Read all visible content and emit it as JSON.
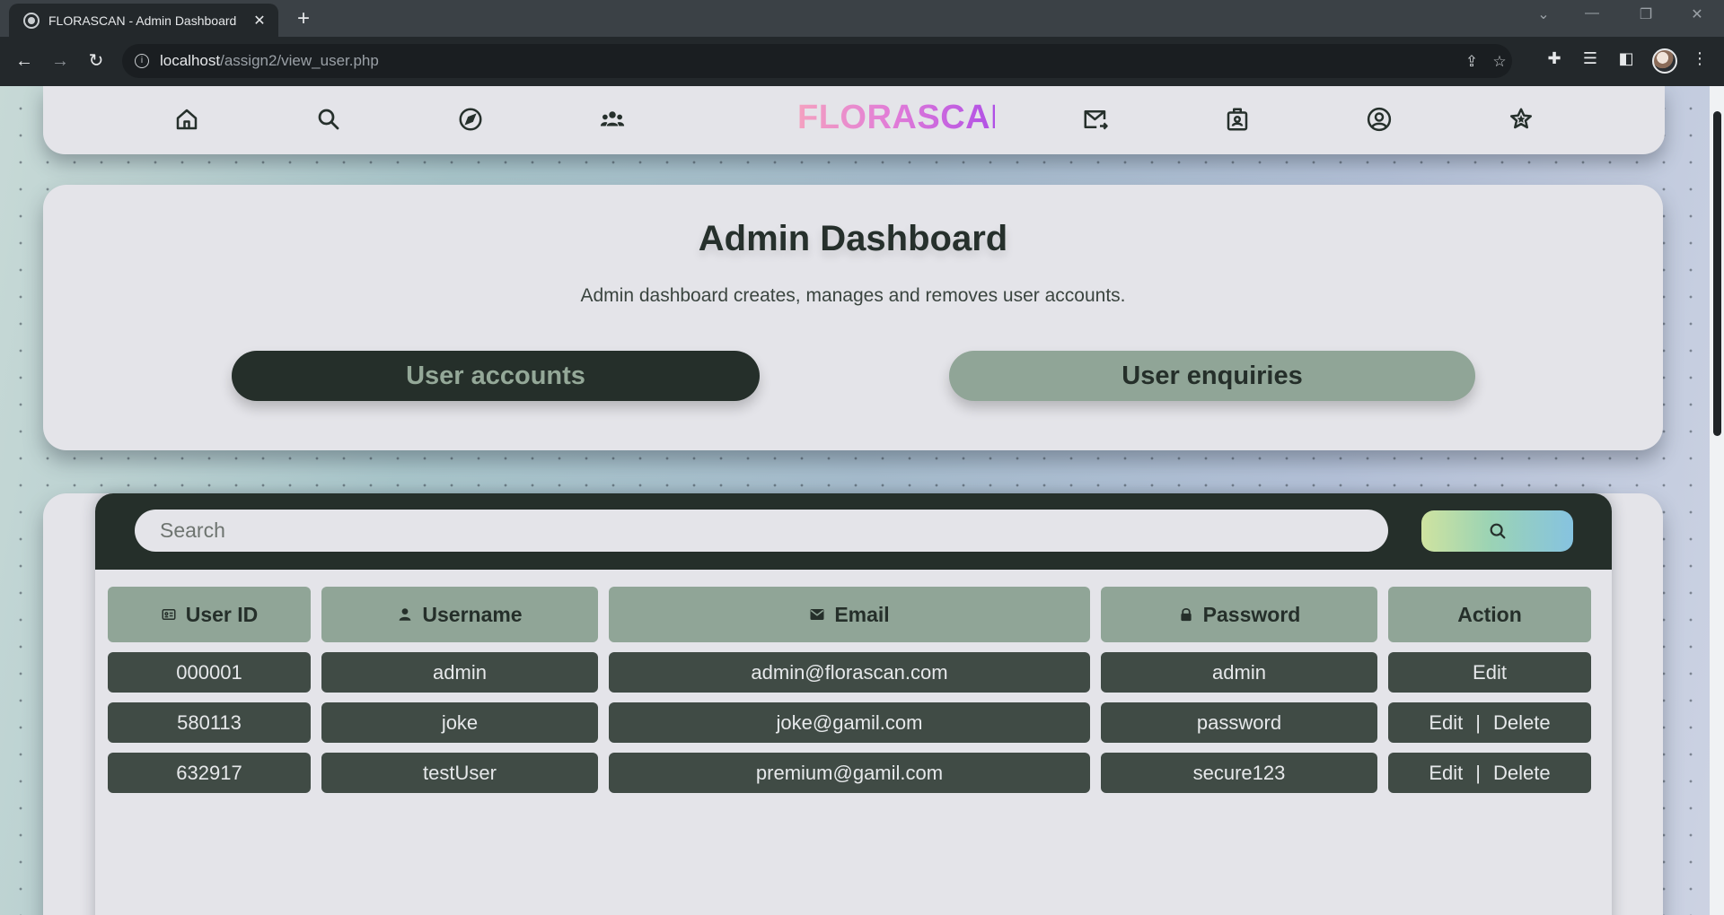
{
  "browser": {
    "tab_title": "FLORASCAN - Admin Dashboard",
    "url_host": "localhost",
    "url_path": "/assign2/view_user.php"
  },
  "header": {
    "logo": "FLORASCAN",
    "nav_icons": [
      "home-icon",
      "search-icon",
      "compass-icon",
      "community-icon",
      "mail-forward-icon",
      "badge-icon",
      "account-icon",
      "rating-icon"
    ]
  },
  "dashboard": {
    "title": "Admin Dashboard",
    "subtitle": "Admin dashboard creates, manages and removes user accounts.",
    "user_accounts_label": "User accounts",
    "user_enquiries_label": "User enquiries"
  },
  "search": {
    "placeholder": "Search"
  },
  "table": {
    "headers": [
      "User ID",
      "Username",
      "Email",
      "Password",
      "Action"
    ],
    "rows": [
      {
        "id": "000001",
        "username": "admin",
        "email": "admin@florascan.com",
        "password": "admin",
        "edit": "Edit",
        "separator": "",
        "delete": ""
      },
      {
        "id": "580113",
        "username": "joke",
        "email": "joke@gamil.com",
        "password": "password",
        "edit": "Edit",
        "separator": "|",
        "delete": "Delete"
      },
      {
        "id": "632917",
        "username": "testUser",
        "email": "premium@gamil.com",
        "password": "secure123",
        "edit": "Edit",
        "separator": "|",
        "delete": "Delete"
      }
    ]
  },
  "colors": {
    "primary_dark": "#252f2a",
    "sage": "#90a597",
    "row_bg": "#404b45",
    "card_bg": "#e4e4e9"
  }
}
